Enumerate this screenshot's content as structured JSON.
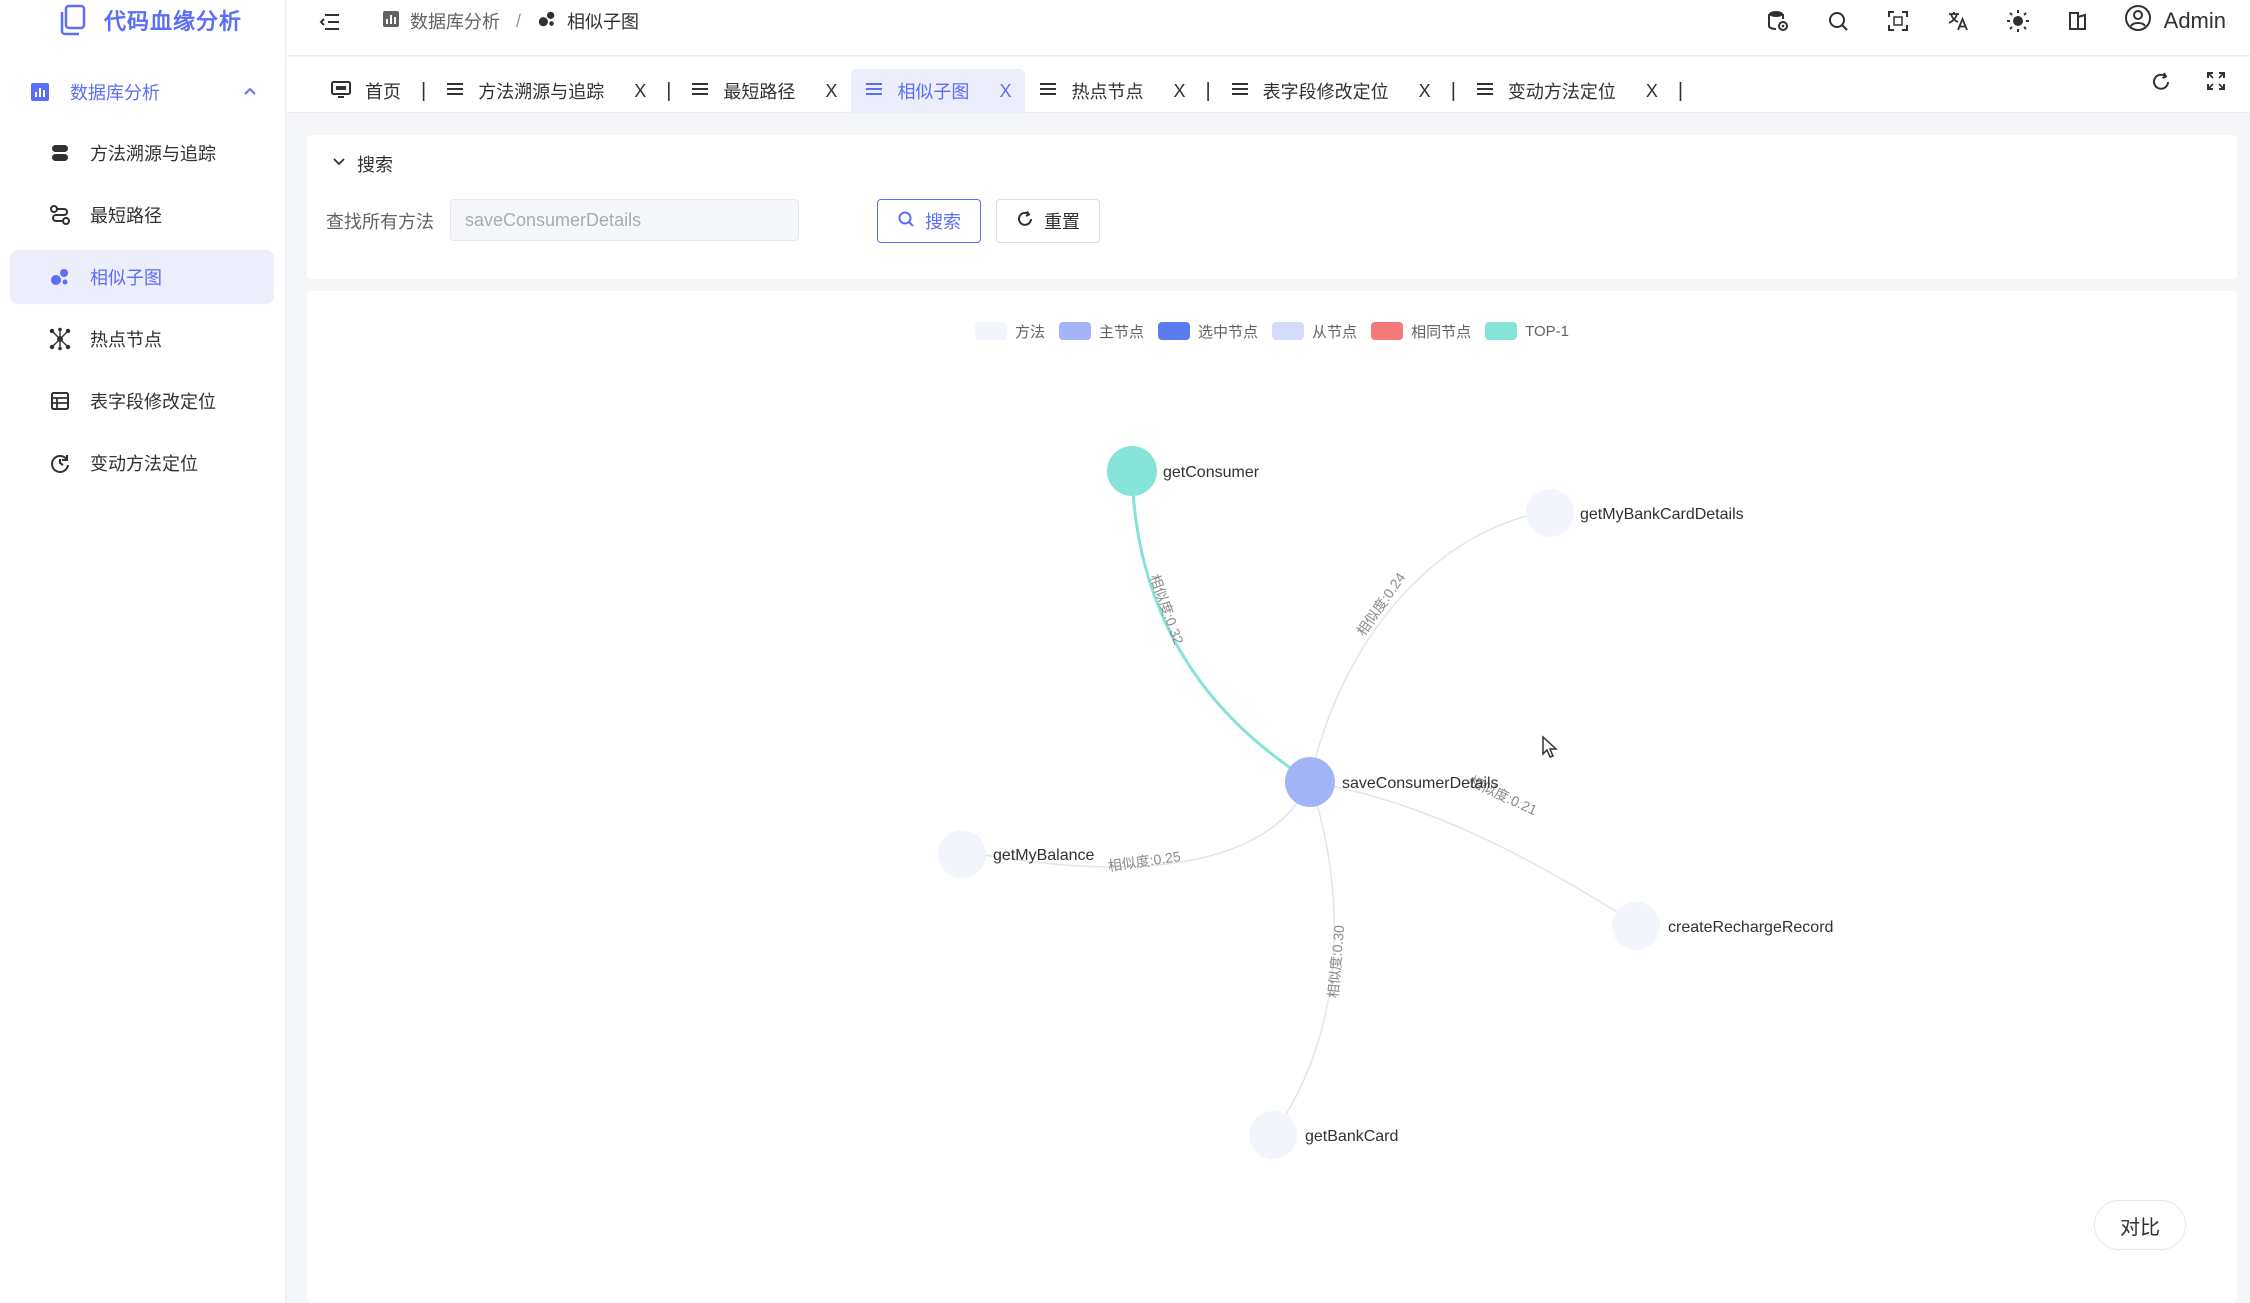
{
  "app": {
    "title": "代码血缘分析"
  },
  "sidebar": {
    "group_label": "数据库分析",
    "items": [
      {
        "label": "方法溯源与追踪",
        "icon": "database-stack-icon",
        "active": false
      },
      {
        "label": "最短路径",
        "icon": "route-icon",
        "active": false
      },
      {
        "label": "相似子图",
        "icon": "bubbles-icon",
        "active": true
      },
      {
        "label": "热点节点",
        "icon": "network-hub-icon",
        "active": false
      },
      {
        "label": "表字段修改定位",
        "icon": "table-list-icon",
        "active": false
      },
      {
        "label": "变动方法定位",
        "icon": "refresh-clock-icon",
        "active": false
      }
    ]
  },
  "header": {
    "breadcrumb": [
      "数据库分析",
      "相似子图"
    ],
    "user": "Admin",
    "icons": [
      "database-settings-icon",
      "search-icon",
      "fullscreen-icon",
      "translate-icon",
      "sun-icon",
      "layout-icon",
      "user-circle-icon"
    ]
  },
  "tabs": [
    {
      "label": "首页",
      "icon": "monitor-icon",
      "closable": false,
      "active": false
    },
    {
      "label": "方法溯源与追踪",
      "icon": "menu-icon",
      "closable": true,
      "active": false
    },
    {
      "label": "最短路径",
      "icon": "menu-icon",
      "closable": true,
      "active": false
    },
    {
      "label": "相似子图",
      "icon": "menu-icon",
      "closable": true,
      "active": true
    },
    {
      "label": "热点节点",
      "icon": "menu-icon",
      "closable": true,
      "active": false
    },
    {
      "label": "表字段修改定位",
      "icon": "menu-icon",
      "closable": true,
      "active": false
    },
    {
      "label": "变动方法定位",
      "icon": "menu-icon",
      "closable": true,
      "active": false
    }
  ],
  "search": {
    "title": "搜索",
    "field_label": "查找所有方法",
    "input_value": "saveConsumerDetails",
    "search_button": "搜索",
    "reset_button": "重置"
  },
  "graph": {
    "legend": [
      {
        "label": "方法",
        "color": "#f3f5fd"
      },
      {
        "label": "主节点",
        "color": "#a3b4f7"
      },
      {
        "label": "选中节点",
        "color": "#5b7bef"
      },
      {
        "label": "从节点",
        "color": "#d3dcfb"
      },
      {
        "label": "相同节点",
        "color": "#f47a7a"
      },
      {
        "label": "TOP-1",
        "color": "#86e3d8"
      }
    ],
    "center": {
      "label": "saveConsumerDetails",
      "role": "主节点",
      "color": "#a3b4f7"
    },
    "nodes": [
      {
        "label": "getConsumer",
        "role": "TOP-1",
        "color": "#86e3d8",
        "similarity": "相似度:0.32"
      },
      {
        "label": "getMyBankCardDetails",
        "role": "方法",
        "color": "#f3f5fd",
        "similarity": "相似度:0.24"
      },
      {
        "label": "createRechargeRecord",
        "role": "方法",
        "color": "#f3f5fd",
        "similarity": "相似度:0.21"
      },
      {
        "label": "getMyBalance",
        "role": "方法",
        "color": "#f3f5fd",
        "similarity": "相似度:0.25"
      },
      {
        "label": "getBankCard",
        "role": "方法",
        "color": "#f3f5fd",
        "similarity": "相似度:0.30"
      }
    ]
  },
  "compare_button": "对比",
  "theme": {
    "accent": "#5b6ef5"
  }
}
